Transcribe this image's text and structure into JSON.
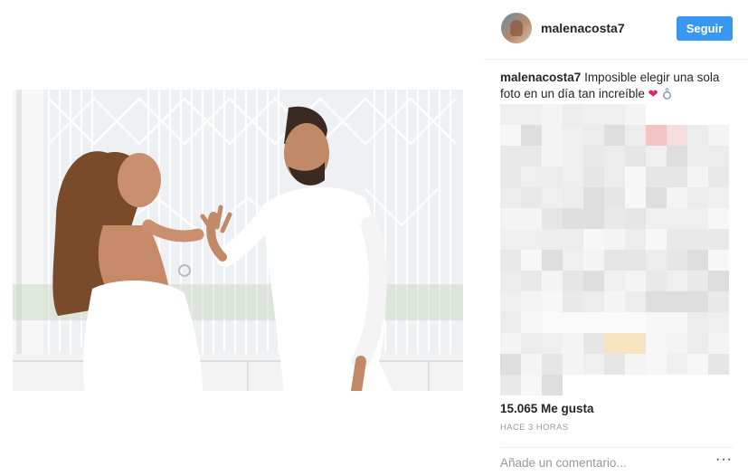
{
  "post": {
    "username": "malenacosta7",
    "follow_label": "Seguir",
    "caption_user": "malenacosta7",
    "caption_text": " Imposible elegir una sola foto en un día tan increíble ",
    "likes": "15.065 Me gusta",
    "time_ago": "HACE 3 HORAS",
    "comment_placeholder": "Añade un comentario...",
    "more_symbol": "···"
  },
  "icons": {
    "heart": "heart-icon",
    "ring": "ring-icon",
    "more": "more-options-icon"
  },
  "colors": {
    "follow_button": "#3897f0",
    "heart": "#e0245e",
    "muted_text": "#999999"
  }
}
